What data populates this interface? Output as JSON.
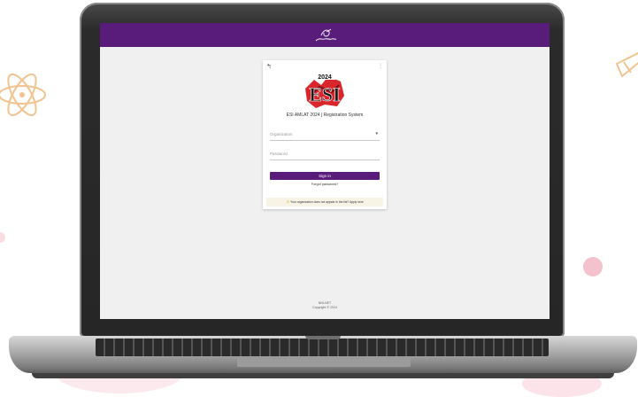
{
  "app": {
    "title": "ESI AMLAT 2024 | Registration System"
  },
  "login": {
    "organization_placeholder": "Organization",
    "password_placeholder": "Password",
    "signin_label": "Sign in",
    "forgot_label": "Forgot password?"
  },
  "notice": {
    "text": "Your organization does not appear in the list? Apply here"
  },
  "footer": {
    "brand": "NNLNET",
    "copyright": "Copyright © 2024"
  },
  "event_logo": {
    "year": "2024",
    "letters": "ESI"
  },
  "colors": {
    "brand_purple": "#5a1c7a",
    "page_bg": "#f0f0f0"
  },
  "icons": [
    "back-arrow-icon",
    "kebab-menu-icon",
    "chevron-down-icon",
    "warning-icon",
    "atom-icon",
    "test-tube-icon"
  ]
}
